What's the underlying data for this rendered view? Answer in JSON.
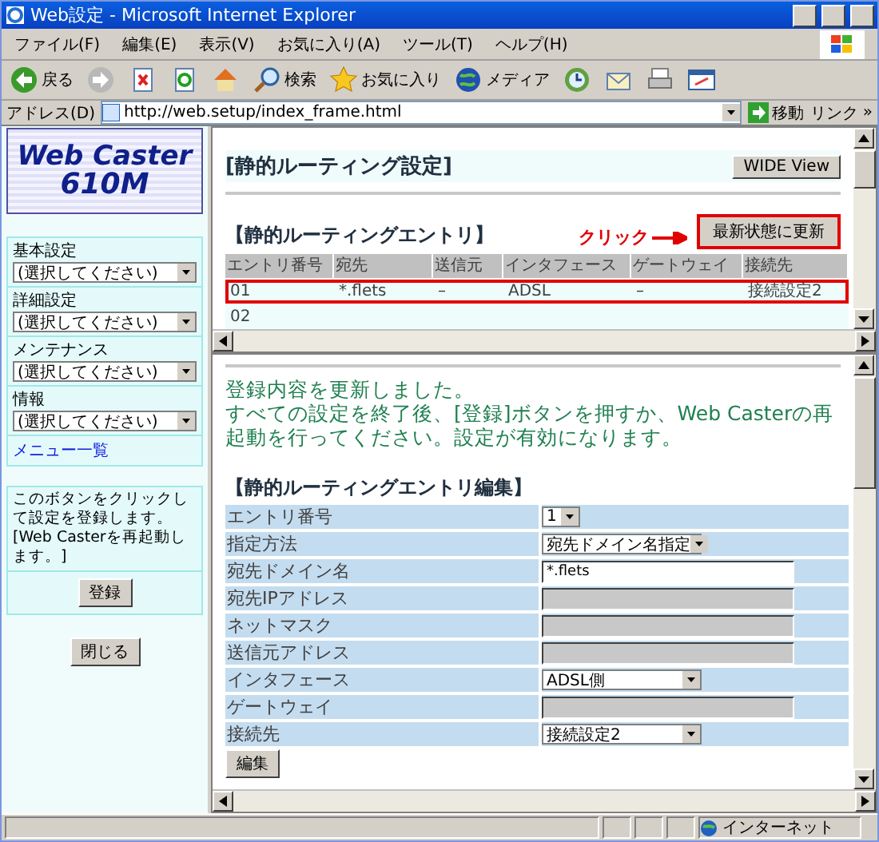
{
  "window": {
    "title": "Web設定 - Microsoft Internet Explorer"
  },
  "menu": [
    "ファイル(F)",
    "編集(E)",
    "表示(V)",
    "お気に入り(A)",
    "ツール(T)",
    "ヘルプ(H)"
  ],
  "toolbar": [
    {
      "kind": "back",
      "label": "戻る"
    },
    {
      "kind": "forward"
    },
    {
      "kind": "stop"
    },
    {
      "kind": "refresh"
    },
    {
      "kind": "home"
    },
    {
      "kind": "search",
      "label": "検索"
    },
    {
      "kind": "favorites",
      "label": "お気に入り"
    },
    {
      "kind": "media",
      "label": "メディア"
    },
    {
      "kind": "history"
    },
    {
      "kind": "mail"
    },
    {
      "kind": "print"
    },
    {
      "kind": "edit"
    }
  ],
  "address": {
    "label": "アドレス(D)",
    "url": "http://web.setup/index_frame.html",
    "go": "移動",
    "links": "リンク",
    "more": "»"
  },
  "sidebar": {
    "logo": [
      "Web Caster",
      "610M"
    ],
    "menus": [
      {
        "label": "基本設定",
        "value": "(選択してください)"
      },
      {
        "label": "詳細設定",
        "value": "(選択してください)"
      },
      {
        "label": "メンテナンス",
        "value": "(選択してください)"
      },
      {
        "label": "情報",
        "value": "(選択してください)"
      }
    ],
    "menu_link": "メニュー一覧",
    "note": "このボタンをクリックして設定を登録します。[Web Casterを再起動します。]",
    "register": "登録",
    "close": "閉じる"
  },
  "routes": {
    "title": "[静的ルーティング設定]",
    "wide_button": "WIDE View",
    "section": "【静的ルーティングエントリ】",
    "callout": "クリック",
    "refresh": {
      "label": "最新状態に更新",
      "highlighted": true
    },
    "columns": [
      "エントリ番号",
      "宛先",
      "送信元",
      "インタフェース",
      "ゲートウェイ",
      "接続先"
    ],
    "rows": [
      {
        "cells": [
          "01",
          "*.flets",
          "–",
          "ADSL",
          "–",
          "接続設定2"
        ],
        "highlighted": true
      },
      {
        "cells": [
          "02"
        ],
        "highlighted": false
      }
    ]
  },
  "editor": {
    "message": [
      "登録内容を更新しました。",
      "すべての設定を終了後、[登録]ボタンを押すか、Web Casterの再起動を行ってください。設定が有効になります。"
    ],
    "section": "【静的ルーティングエントリ編集】",
    "fields": [
      {
        "label": "エントリ番号",
        "kind": "select",
        "value": "1"
      },
      {
        "label": "指定方法",
        "kind": "select",
        "value": "宛先ドメイン名指定"
      },
      {
        "label": "宛先ドメイン名",
        "kind": "input",
        "value": "*.flets"
      },
      {
        "label": "宛先IPアドレス",
        "kind": "disabled"
      },
      {
        "label": "ネットマスク",
        "kind": "disabled"
      },
      {
        "label": "送信元アドレス",
        "kind": "disabled"
      },
      {
        "label": "インタフェース",
        "kind": "select",
        "value": "ADSL側"
      },
      {
        "label": "ゲートウェイ",
        "kind": "disabled"
      },
      {
        "label": "接続先",
        "kind": "select",
        "value": "接続設定2"
      }
    ],
    "edit_button": "編集"
  },
  "status_bar": {
    "zone": "インターネット"
  }
}
